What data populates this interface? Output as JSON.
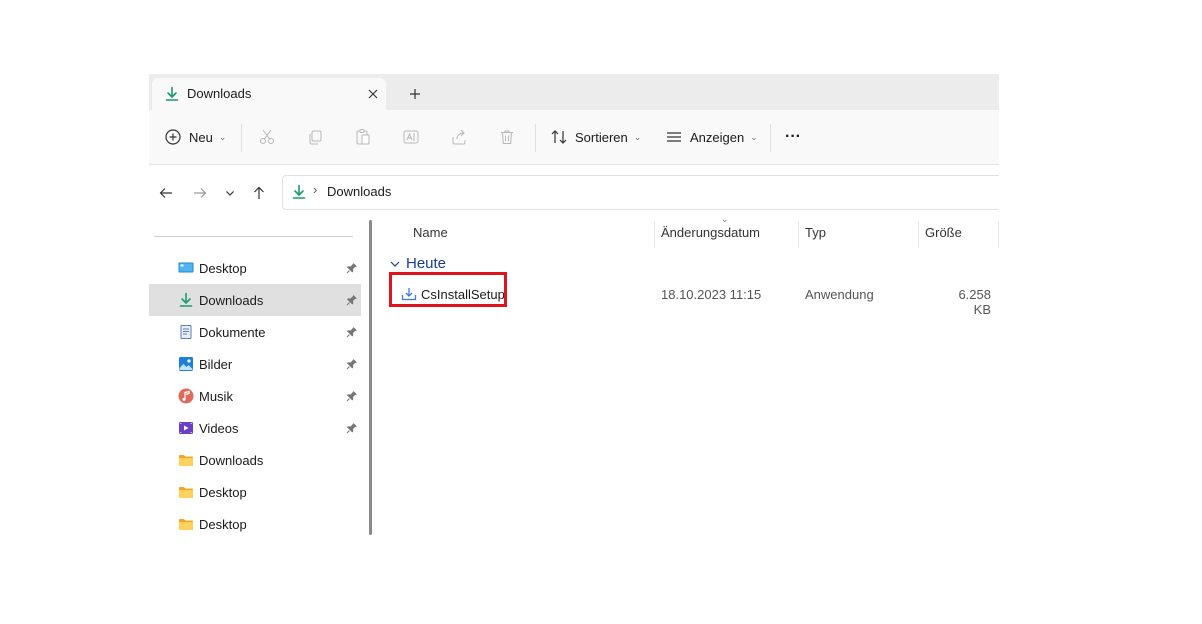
{
  "tab": {
    "title": "Downloads",
    "close_icon": "close-icon",
    "new_tab_icon": "plus-icon"
  },
  "toolbar": {
    "new_label": "Neu",
    "sort_label": "Sortieren",
    "view_label": "Anzeigen",
    "more_label": "···"
  },
  "address": {
    "separator": "›",
    "path": "Downloads"
  },
  "sidebar": {
    "items": [
      {
        "label": "Desktop",
        "icon": "desktop-icon",
        "pinned": true
      },
      {
        "label": "Downloads",
        "icon": "download-icon",
        "pinned": true,
        "selected": true
      },
      {
        "label": "Dokumente",
        "icon": "documents-icon",
        "pinned": true
      },
      {
        "label": "Bilder",
        "icon": "pictures-icon",
        "pinned": true
      },
      {
        "label": "Musik",
        "icon": "music-icon",
        "pinned": true
      },
      {
        "label": "Videos",
        "icon": "videos-icon",
        "pinned": true
      },
      {
        "label": "Downloads",
        "icon": "folder-icon",
        "pinned": false
      },
      {
        "label": "Desktop",
        "icon": "folder-icon",
        "pinned": false
      },
      {
        "label": "Desktop",
        "icon": "folder-icon",
        "pinned": false
      }
    ]
  },
  "columns": {
    "name": "Name",
    "date": "Änderungsdatum",
    "type": "Typ",
    "size": "Größe"
  },
  "group": {
    "label": "Heute"
  },
  "files": [
    {
      "name": "CsInstallSetup",
      "date": "18.10.2023 11:15",
      "type": "Anwendung",
      "size": "6.258 KB"
    }
  ],
  "colors": {
    "accent": "#1a9b6c",
    "highlight": "#e0141e",
    "group_text": "#1a3c8c"
  }
}
